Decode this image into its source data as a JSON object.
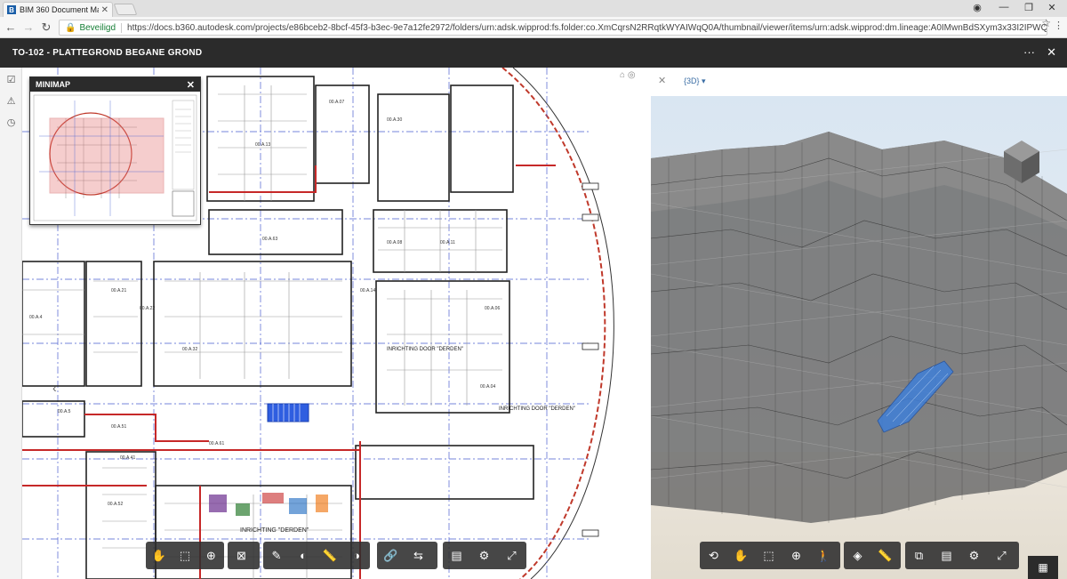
{
  "browser": {
    "tab_title": "BIM 360 Document Man",
    "tab_favicon": "B",
    "secure_label": "Beveiligd",
    "url": "https://docs.b360.autodesk.com/projects/e86bceb2-8bcf-45f3-b3ec-9e7a12fe2972/folders/urn:adsk.wipprod:fs.folder:co.XmCqrsN2RRqtkWYAIWqQ0A/thumbnail/viewer/items/urn:adsk.wipprod:dm.lineage:A0IMwnBdSXym3x33I2IPWQ"
  },
  "header": {
    "title": "TO-102 - PLATTEGROND BEGANE GROND"
  },
  "minimap": {
    "title": "MINIMAP"
  },
  "view3d": {
    "view_name": "{3D}"
  },
  "plan_labels": {
    "annotation_1": "INRICHTING DOOR \"DERDEN\"",
    "annotation_2": "INRICHTING DOOR \"DERDEN\"",
    "annotation_3": "INRICHTING \"DERDEN\""
  },
  "toolbar_2d": [
    "pan",
    "zoom-window",
    "zoom-fit",
    "fit-view",
    "markup",
    "hide",
    "measure",
    "visibility",
    "link",
    "compare",
    "sheets",
    "settings",
    "fullscreen"
  ],
  "toolbar_3d": [
    "orbit",
    "pan",
    "fit-view",
    "zoom",
    "first-person",
    "section",
    "measure",
    "model-browser",
    "properties",
    "settings",
    "fullscreen"
  ],
  "colors": {
    "header_bg": "#2b2b2b",
    "accent_blue": "#3b6ea5",
    "secure_green": "#188038",
    "selection_blue": "#3f7fd9"
  }
}
